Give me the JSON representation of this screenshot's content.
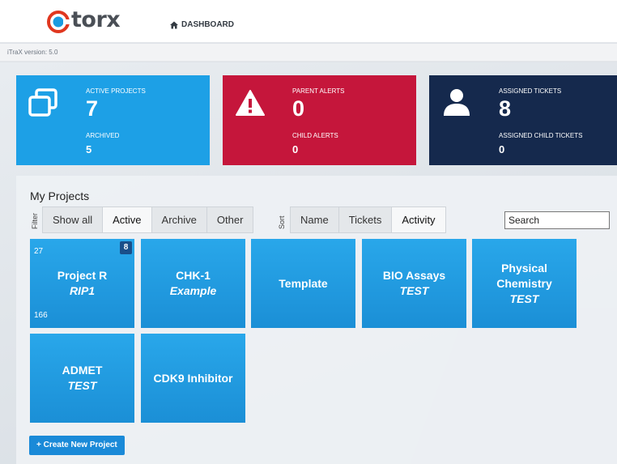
{
  "header": {
    "logo_text": "torx",
    "nav_dashboard": "DASHBOARD"
  },
  "version_text": "iTraX version: 5.0",
  "stats": {
    "active_projects_label": "ACTIVE PROJECTS",
    "active_projects_value": "7",
    "archived_label": "ARCHIVED",
    "archived_value": "5",
    "parent_alerts_label": "PARENT ALERTS",
    "parent_alerts_value": "0",
    "child_alerts_label": "CHILD ALERTS",
    "child_alerts_value": "0",
    "assigned_tickets_label": "ASSIGNED TICKETS",
    "assigned_tickets_value": "8",
    "assigned_child_label": "ASSIGNED CHILD TICKETS",
    "assigned_child_value": "0"
  },
  "projects": {
    "title": "My Projects",
    "filter_label": "Filter",
    "filter_options": [
      "Show all",
      "Active",
      "Archive",
      "Other"
    ],
    "filter_selected": "Active",
    "sort_label": "Sort",
    "sort_options": [
      "Name",
      "Tickets",
      "Activity"
    ],
    "sort_selected": "Activity",
    "search_placeholder": "Search",
    "create_button": "+ Create New Project",
    "tiles": [
      {
        "name": "Project R",
        "sub": "RIP1",
        "top_left": "27",
        "badge": "8",
        "bottom_left": "166"
      },
      {
        "name": "CHK-1",
        "sub": "Example"
      },
      {
        "name": "Template",
        "sub": ""
      },
      {
        "name": "BIO Assays",
        "sub": "TEST"
      },
      {
        "name": "Physical Chemistry",
        "sub": "TEST"
      },
      {
        "name": "ADMET",
        "sub": "TEST"
      },
      {
        "name": "CDK9 Inhibitor",
        "sub": ""
      }
    ]
  },
  "colors": {
    "blue": "#1da0e6",
    "red": "#c5163b",
    "navy": "#15294d",
    "tile": "#1b8fd6"
  }
}
